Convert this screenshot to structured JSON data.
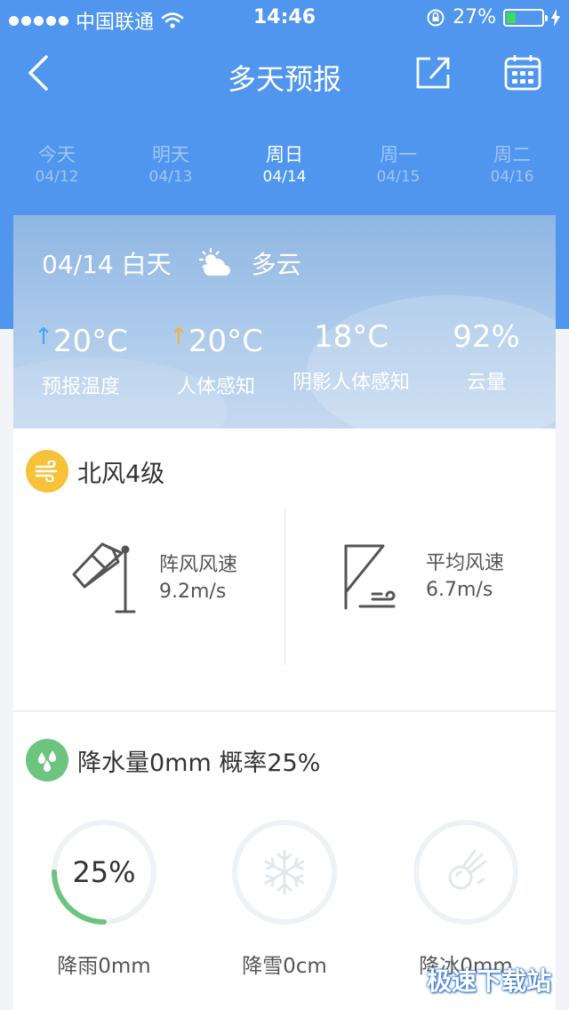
{
  "status_bar": {
    "carrier": "中国联通",
    "time": "14:46",
    "battery": "27%",
    "battery_level": 0.27
  },
  "nav": {
    "title": "多天预报",
    "back_icon": "chevron-left-icon",
    "share_icon": "share-icon",
    "calendar_icon": "calendar-icon"
  },
  "days": [
    {
      "name": "今天",
      "date": "04/12"
    },
    {
      "name": "明天",
      "date": "04/13"
    },
    {
      "name": "周日",
      "date": "04/14"
    },
    {
      "name": "周一",
      "date": "04/15"
    },
    {
      "name": "周二",
      "date": "04/16"
    }
  ],
  "active_day": 2,
  "summary": {
    "date_period": "04/14 白天",
    "condition": "多云",
    "condition_icon": "partly-cloudy-icon",
    "metrics": [
      {
        "value": "20°C",
        "label": "预报温度",
        "arrow": "↑"
      },
      {
        "value": "20°C",
        "label": "人体感知",
        "arrow": "↑"
      },
      {
        "value": "18°C",
        "label": "阴影人体感知"
      },
      {
        "value": "92%",
        "label": "云量"
      }
    ]
  },
  "wind": {
    "title": "北风4级",
    "gust_label": "阵风风速",
    "gust_value": "9.2m/s",
    "avg_label": "平均风速",
    "avg_value": "6.7m/s",
    "accent": "#f7c23a"
  },
  "precip": {
    "title": "降水量0mm 概率25%",
    "accent": "#6cc47f",
    "rain_pct": "25%",
    "rain_fraction": 0.25,
    "rain_label": "降雨0mm",
    "snow_label": "降雪0cm",
    "hail_label": "降冰0mm"
  },
  "watermark": "极速下载站",
  "colors": {
    "header_blue": "#5096ee",
    "ring_green": "#6cc47f",
    "ring_track": "#eef1f5"
  }
}
